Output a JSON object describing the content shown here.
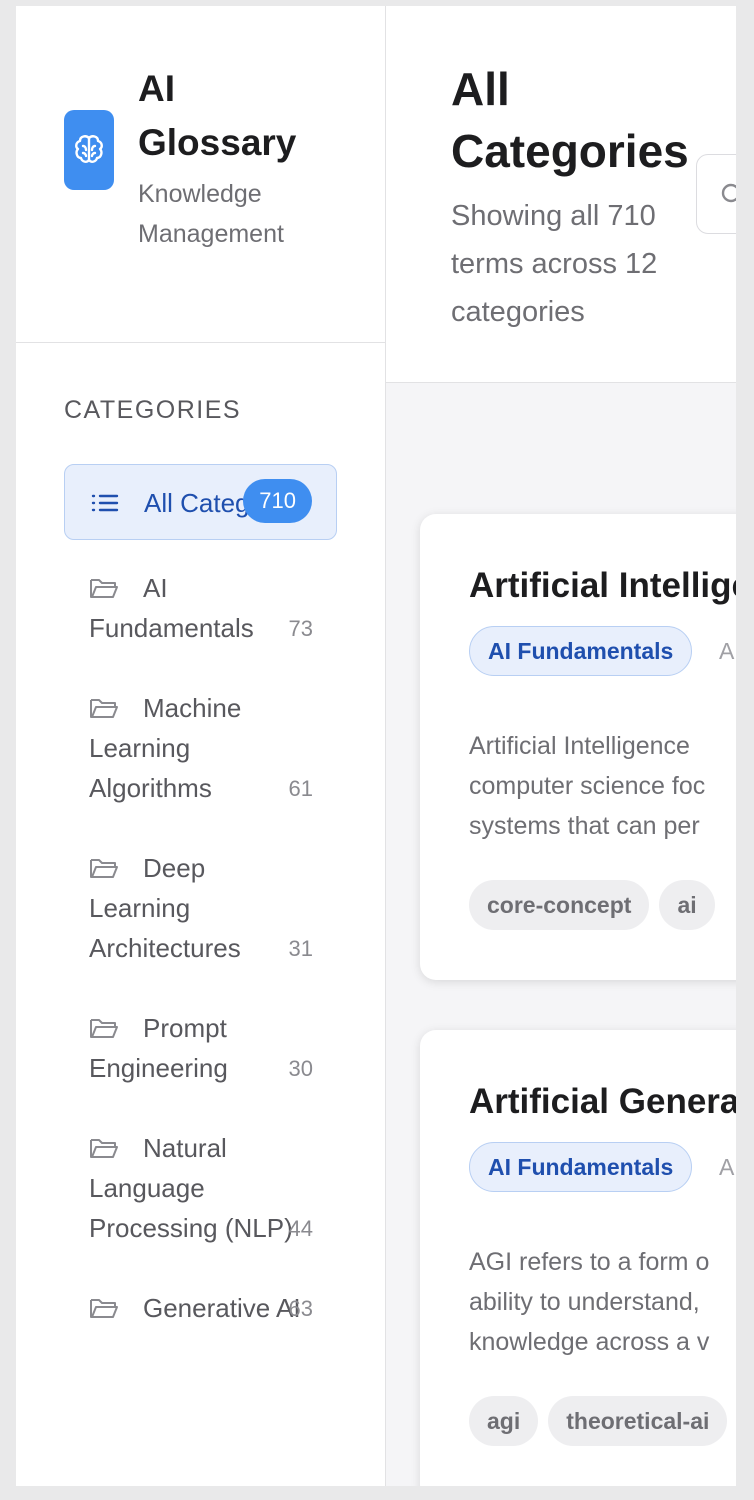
{
  "brand": {
    "title": "AI Glossary",
    "subtitle": "Knowledge Management"
  },
  "sidebar": {
    "heading": "CATEGORIES",
    "items": [
      {
        "label": "All Categories",
        "count": "710",
        "icon": "list-icon",
        "active": true
      },
      {
        "label": "AI Fundamentals",
        "count": "73",
        "icon": "folder-icon"
      },
      {
        "label": "Machine Learning Algorithms",
        "count": "61",
        "icon": "folder-icon"
      },
      {
        "label": "Deep Learning Architectures",
        "count": "31",
        "icon": "folder-icon"
      },
      {
        "label": "Prompt Engineering",
        "count": "30",
        "icon": "folder-icon"
      },
      {
        "label": "Natural Language Processing (NLP)",
        "count": "44",
        "icon": "folder-icon"
      },
      {
        "label": "Generative AI",
        "count": "63",
        "icon": "folder-icon"
      }
    ]
  },
  "main": {
    "title": "All Categories",
    "subtitle": "Showing all 710 terms across 12 categories",
    "search_icon": "search-icon",
    "cards": [
      {
        "title": "Artificial Intellige",
        "category": "AI Fundamentals",
        "meta": "A",
        "description": [
          "Artificial Intelligence",
          "computer science foc",
          "systems that can per"
        ],
        "tags": [
          "core-concept",
          "ai"
        ]
      },
      {
        "title": "Artificial Genera",
        "category": "AI Fundamentals",
        "meta": "A",
        "description": [
          "AGI refers to a form o",
          "ability to understand,",
          "knowledge across a v"
        ],
        "tags": [
          "agi",
          "theoretical-ai"
        ]
      }
    ]
  },
  "colors": {
    "accent": "#3f8ef0",
    "active_bg": "#e8effc",
    "active_text": "#1f4fae"
  }
}
